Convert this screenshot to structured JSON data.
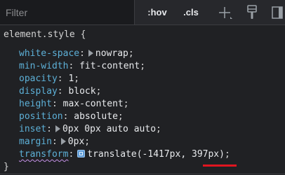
{
  "toolbar": {
    "filter_placeholder": "Filter",
    "hov_label": ":hov",
    "cls_label": ".cls",
    "icons": [
      "plus-icon",
      "paint-brush-icon",
      "toggle-sidebar-icon"
    ]
  },
  "rule": {
    "selector": "element.style",
    "open_brace": "{",
    "close_brace": "}",
    "declarations": [
      {
        "property": "white-space",
        "value": "nowrap",
        "has_triangle": true
      },
      {
        "property": "min-width",
        "value": "fit-content"
      },
      {
        "property": "opacity",
        "value": "1"
      },
      {
        "property": "display",
        "value": "block"
      },
      {
        "property": "height",
        "value": "max-content"
      },
      {
        "property": "position",
        "value": "absolute"
      },
      {
        "property": "inset",
        "value": "0px 0px auto auto",
        "has_triangle": true
      },
      {
        "property": "margin",
        "value": "0px",
        "has_triangle": true
      },
      {
        "property": "transform",
        "value": "translate(-1417px, 397px)",
        "value_part1": "translate(-1417px, ",
        "value_highlight": "397px",
        "value_part2": ")",
        "has_swatch": true
      }
    ]
  },
  "colors": {
    "background": "#202124",
    "property": "#5db0d7",
    "highlight_underline": "#e0151f"
  }
}
